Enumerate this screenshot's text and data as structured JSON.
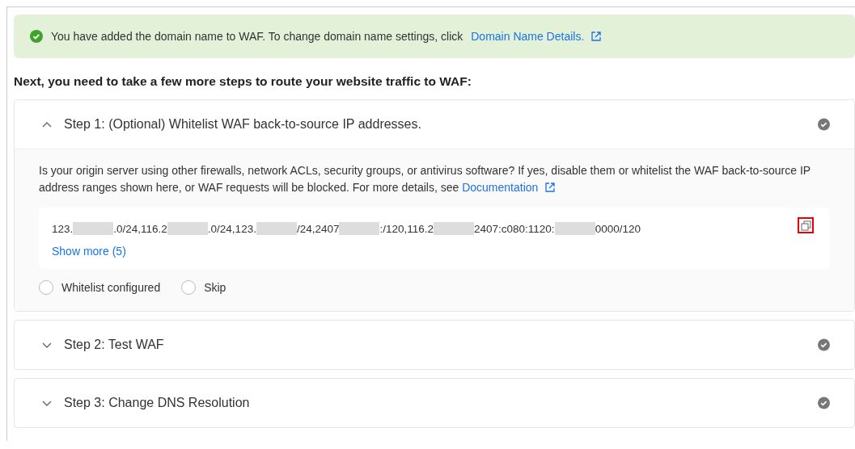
{
  "banner": {
    "text": "You have added the domain name to WAF. To change domain name settings, click",
    "link": "Domain Name Details."
  },
  "heading": "Next, you need to take a few more steps to route your website traffic to WAF:",
  "steps": [
    {
      "title": "Step 1: (Optional) Whitelist WAF back-to-source IP addresses.",
      "expanded": true,
      "description": "Is your origin server using other firewalls, network ACLs, security groups, or antivirus software? If yes, disable them or whitelist the WAF back-to-source IP address ranges shown here, or WAF requests will be blocked. For more details, see",
      "doc_link": "Documentation",
      "ip_parts": [
        {
          "kind": "text",
          "text": "123."
        },
        {
          "kind": "redacted"
        },
        {
          "kind": "text",
          "text": ".0/24,116.2"
        },
        {
          "kind": "redacted"
        },
        {
          "kind": "text",
          "text": ".0/24,123."
        },
        {
          "kind": "redacted"
        },
        {
          "kind": "text",
          "text": "/24,2407"
        },
        {
          "kind": "redacted"
        },
        {
          "kind": "text",
          "text": ":/120,116.2"
        },
        {
          "kind": "redacted"
        },
        {
          "kind": "text",
          "text": "2407:c080:1120:"
        },
        {
          "kind": "redacted"
        },
        {
          "kind": "text",
          "text": "0000/120"
        }
      ],
      "copy_highlighted": true,
      "show_more": "Show more (5)",
      "options": [
        {
          "label": "Whitelist configured",
          "selected": false
        },
        {
          "label": "Skip",
          "selected": false
        }
      ]
    },
    {
      "title": "Step 2: Test WAF",
      "expanded": false
    },
    {
      "title": "Step 3: Change DNS Resolution",
      "expanded": false
    }
  ]
}
